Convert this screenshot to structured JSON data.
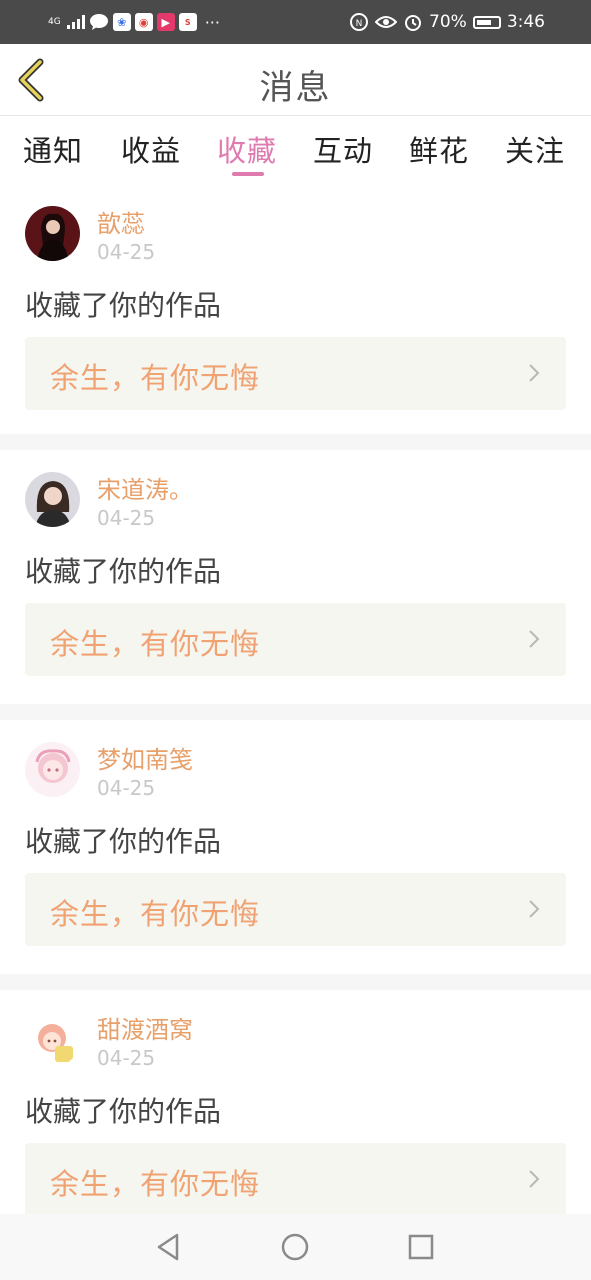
{
  "status_bar": {
    "network": "4G",
    "battery": "70%",
    "time": "3:46",
    "app_icons": [
      "chat-icon",
      "baidu-icon",
      "weibo-icon",
      "video-icon",
      "sohu-icon"
    ],
    "more": "···",
    "colors": {
      "background": "#4a4a4a",
      "foreground": "#ffffff"
    }
  },
  "header": {
    "title": "消息",
    "back_icon": "chevron-left-icon",
    "colors": {
      "back": "#e6d35a"
    }
  },
  "tabs": {
    "items": [
      "通知",
      "收益",
      "收藏",
      "互动",
      "鲜花",
      "关注"
    ],
    "active_index": 2,
    "colors": {
      "active": "#e07bb0",
      "inactive": "#222222"
    }
  },
  "notifications": [
    {
      "username": "歆蕊",
      "date": "04-25",
      "message": "收藏了你的作品",
      "work_title": "余生，有你无悔"
    },
    {
      "username": "宋道涛。",
      "date": "04-25",
      "message": "收藏了你的作品",
      "work_title": "余生，有你无悔"
    },
    {
      "username": "梦如南笺",
      "date": "04-25",
      "message": "收藏了你的作品",
      "work_title": "余生，有你无悔"
    },
    {
      "username": "甜渡酒窝",
      "date": "04-25",
      "message": "收藏了你的作品",
      "work_title": "余生，有你无悔"
    }
  ],
  "colors": {
    "username": "#e8a06b",
    "work_title": "#f0a272",
    "date": "#c8c8c8",
    "work_box": "#f6f6f0"
  },
  "nav_bar": {
    "icons": [
      "back-triangle-icon",
      "home-circle-icon",
      "recents-square-icon"
    ]
  }
}
